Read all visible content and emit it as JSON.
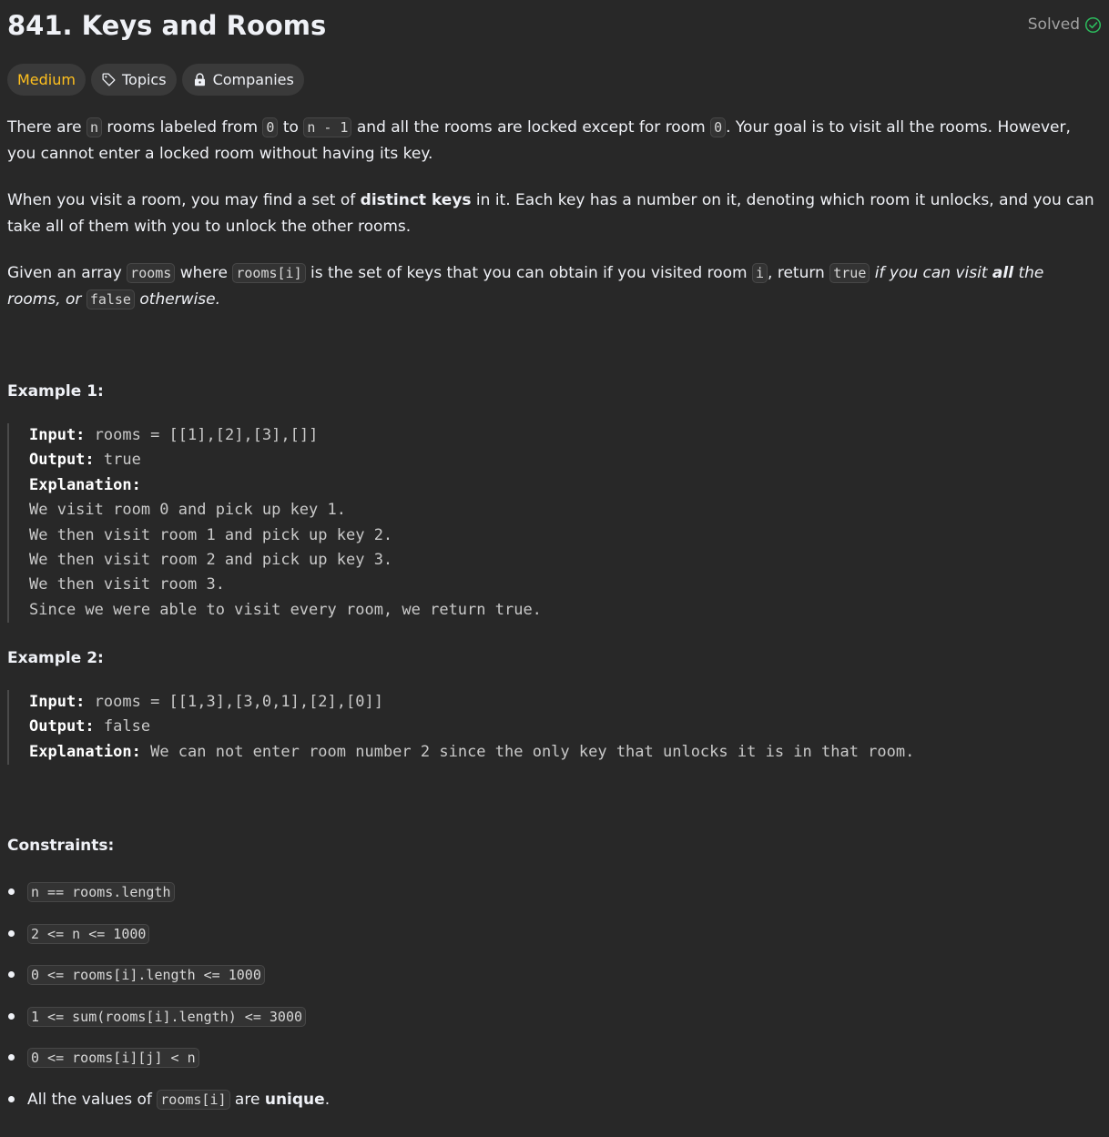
{
  "header": {
    "title": "841. Keys and Rooms",
    "status": "Solved"
  },
  "tags": {
    "difficulty": "Medium",
    "topics": "Topics",
    "companies": "Companies"
  },
  "description": {
    "p1": {
      "t1": "There are ",
      "c1": "n",
      "t2": " rooms labeled from ",
      "c2": "0",
      "t3": " to ",
      "c3": "n - 1",
      "t4": " and all the rooms are locked except for room ",
      "c4": "0",
      "t5": ". Your goal is to visit all the rooms. However, you cannot enter a locked room without having its key."
    },
    "p2": {
      "t1": "When you visit a room, you may find a set of ",
      "b1": "distinct keys",
      "t2": " in it. Each key has a number on it, denoting which room it unlocks, and you can take all of them with you to unlock the other rooms."
    },
    "p3": {
      "t1": "Given an array ",
      "c1": "rooms",
      "t2": " where ",
      "c2": "rooms[i]",
      "t3": " is the set of keys that you can obtain if you visited room ",
      "c3": "i",
      "t4": ", return ",
      "c4": "true",
      "e1": "if you can visit",
      "eb1": "all",
      "e2": "the rooms, or",
      "c5": "false",
      "e3": "otherwise."
    }
  },
  "examples": [
    {
      "title": "Example 1:",
      "input_label": "Input:",
      "input": "rooms = [[1],[2],[3],[]]",
      "output_label": "Output:",
      "output": "true",
      "explanation_label": "Explanation:",
      "explanation_lines": [
        "We visit room 0 and pick up key 1.",
        "We then visit room 1 and pick up key 2.",
        "We then visit room 2 and pick up key 3.",
        "We then visit room 3.",
        "Since we were able to visit every room, we return true."
      ]
    },
    {
      "title": "Example 2:",
      "input_label": "Input:",
      "input": "rooms = [[1,3],[3,0,1],[2],[0]]",
      "output_label": "Output:",
      "output": "false",
      "explanation_label": "Explanation:",
      "explanation": "We can not enter room number 2 since the only key that unlocks it is in that room."
    }
  ],
  "constraints": {
    "title": "Constraints:",
    "items": [
      "n == rooms.length",
      "2 <= n <= 1000",
      "0 <= rooms[i].length <= 1000",
      "1 <= sum(rooms[i].length) <= 3000",
      "0 <= rooms[i][j] < n"
    ],
    "last": {
      "t1": "All the values of ",
      "c1": "rooms[i]",
      "t2": " are ",
      "b1": "unique",
      "t3": "."
    }
  },
  "colors": {
    "background": "#282828",
    "medium": "#ffc01e",
    "solved_check": "#2cbb5d"
  },
  "icons": [
    "check-circle-icon",
    "tag-icon",
    "lock-icon"
  ]
}
